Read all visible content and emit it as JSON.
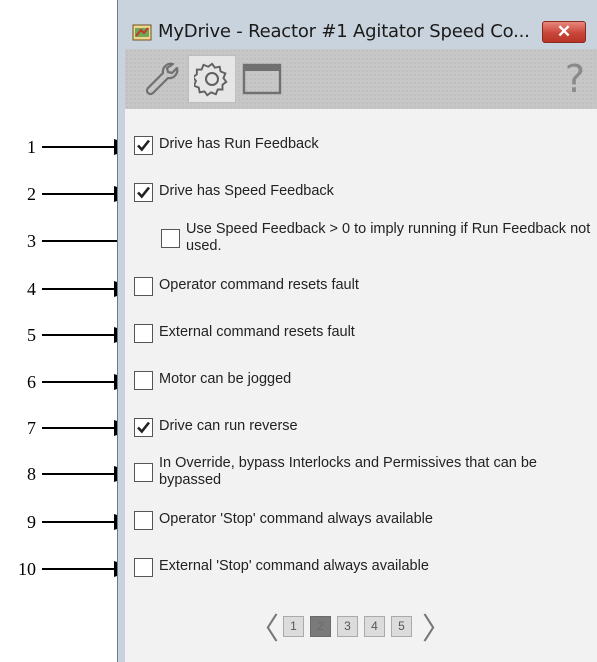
{
  "window": {
    "title": "MyDrive - Reactor #1 Agitator Speed Co...",
    "close_glyph": "✕"
  },
  "toolbar": {
    "buttons": [
      {
        "icon": "wrench-icon",
        "active": false
      },
      {
        "icon": "gear-icon",
        "active": true
      },
      {
        "icon": "window-icon",
        "active": false
      }
    ],
    "help_label": "?"
  },
  "options": [
    {
      "label": "Drive has Run Feedback",
      "checked": true
    },
    {
      "label": "Drive has Speed Feedback",
      "checked": true
    },
    {
      "label": "Use Speed Feedback > 0 to imply running if Run Feedback not used.",
      "checked": false
    },
    {
      "label": "Operator command resets fault",
      "checked": false
    },
    {
      "label": "External command resets fault",
      "checked": false
    },
    {
      "label": "Motor can be jogged",
      "checked": false
    },
    {
      "label": "Drive can run reverse",
      "checked": true
    },
    {
      "label": "In Override, bypass Interlocks and Permissives that can be bypassed",
      "checked": false
    },
    {
      "label": "Operator 'Stop' command always available",
      "checked": false
    },
    {
      "label": "External 'Stop' command always available",
      "checked": false
    }
  ],
  "pager": {
    "prev": "〈",
    "next": "〉",
    "pages": [
      "1",
      "2",
      "3",
      "4",
      "5"
    ],
    "current": "2"
  },
  "callouts": [
    "1",
    "2",
    "3",
    "4",
    "5",
    "6",
    "7",
    "8",
    "9",
    "10"
  ]
}
